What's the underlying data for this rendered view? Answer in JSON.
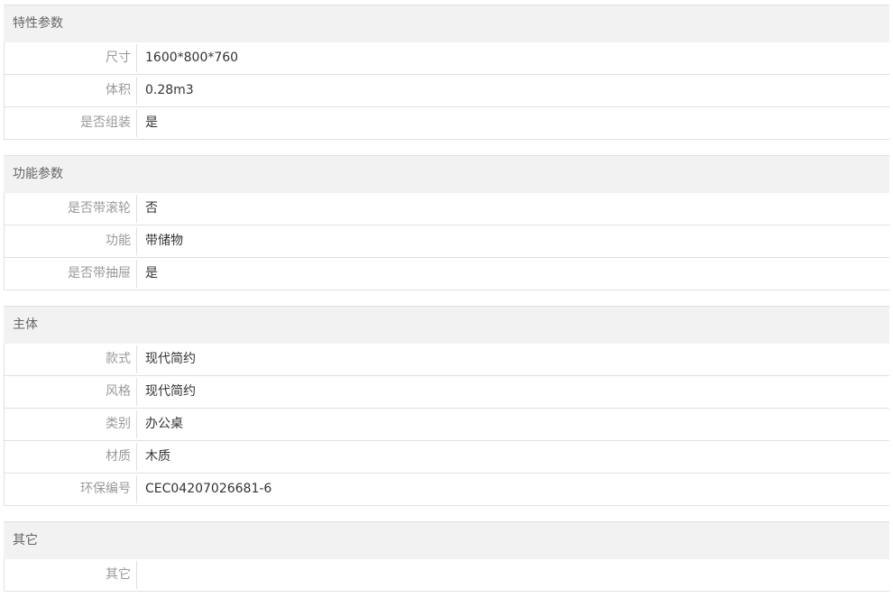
{
  "sections": [
    {
      "title": "特性参数",
      "rows": [
        {
          "label": "尺寸",
          "value": "1600*800*760"
        },
        {
          "label": "体积",
          "value": "0.28m3"
        },
        {
          "label": "是否组装",
          "value": "是"
        }
      ]
    },
    {
      "title": "功能参数",
      "rows": [
        {
          "label": "是否带滚轮",
          "value": "否"
        },
        {
          "label": "功能",
          "value": "带储物"
        },
        {
          "label": "是否带抽屉",
          "value": "是"
        }
      ]
    },
    {
      "title": "主体",
      "rows": [
        {
          "label": "款式",
          "value": "现代简约"
        },
        {
          "label": "风格",
          "value": "现代简约"
        },
        {
          "label": "类别",
          "value": "办公桌"
        },
        {
          "label": "材质",
          "value": "木质"
        },
        {
          "label": "环保编号",
          "value": "CEC04207026681-6"
        }
      ]
    },
    {
      "title": "其它",
      "rows": [
        {
          "label": "其它",
          "value": ""
        }
      ]
    }
  ]
}
